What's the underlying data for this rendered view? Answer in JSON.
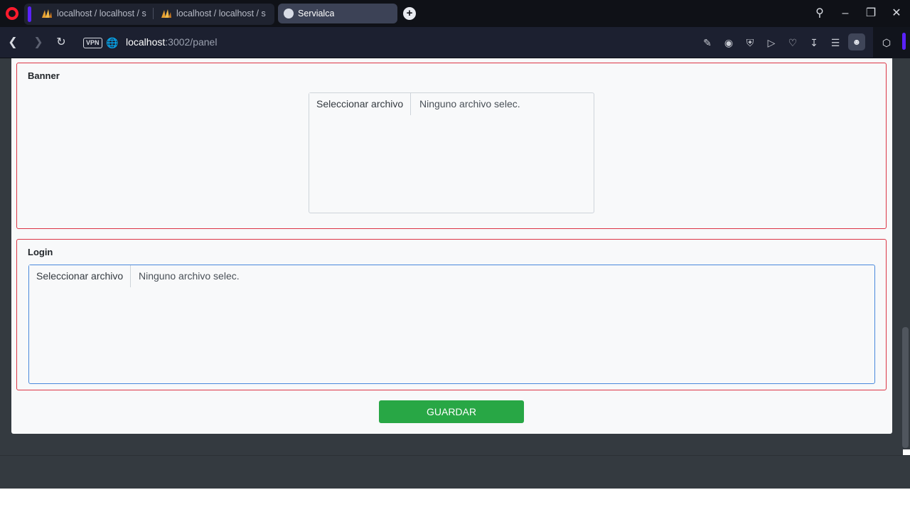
{
  "browser": {
    "tabs": [
      {
        "title": "localhost / localhost / servialca",
        "favicon": "phpmyadmin-icon"
      },
      {
        "title": "localhost / localhost / servialca",
        "favicon": "phpmyadmin-icon"
      },
      {
        "title": "Servialca",
        "favicon": "globe-icon",
        "active": true
      }
    ],
    "vpn_label": "VPN",
    "url_host": "localhost",
    "url_rest": ":3002/panel"
  },
  "page": {
    "banner": {
      "title": "Banner",
      "file_button": "Seleccionar archivo",
      "file_status": "Ninguno archivo selec."
    },
    "login": {
      "title": "Login",
      "file_button": "Seleccionar archivo",
      "file_status": "Ninguno archivo selec."
    },
    "save_label": "GUARDAR"
  },
  "colors": {
    "section_border": "#dc3545",
    "save_button": "#28a745",
    "focus_border": "#4a89dc",
    "page_background": "#343a40"
  }
}
